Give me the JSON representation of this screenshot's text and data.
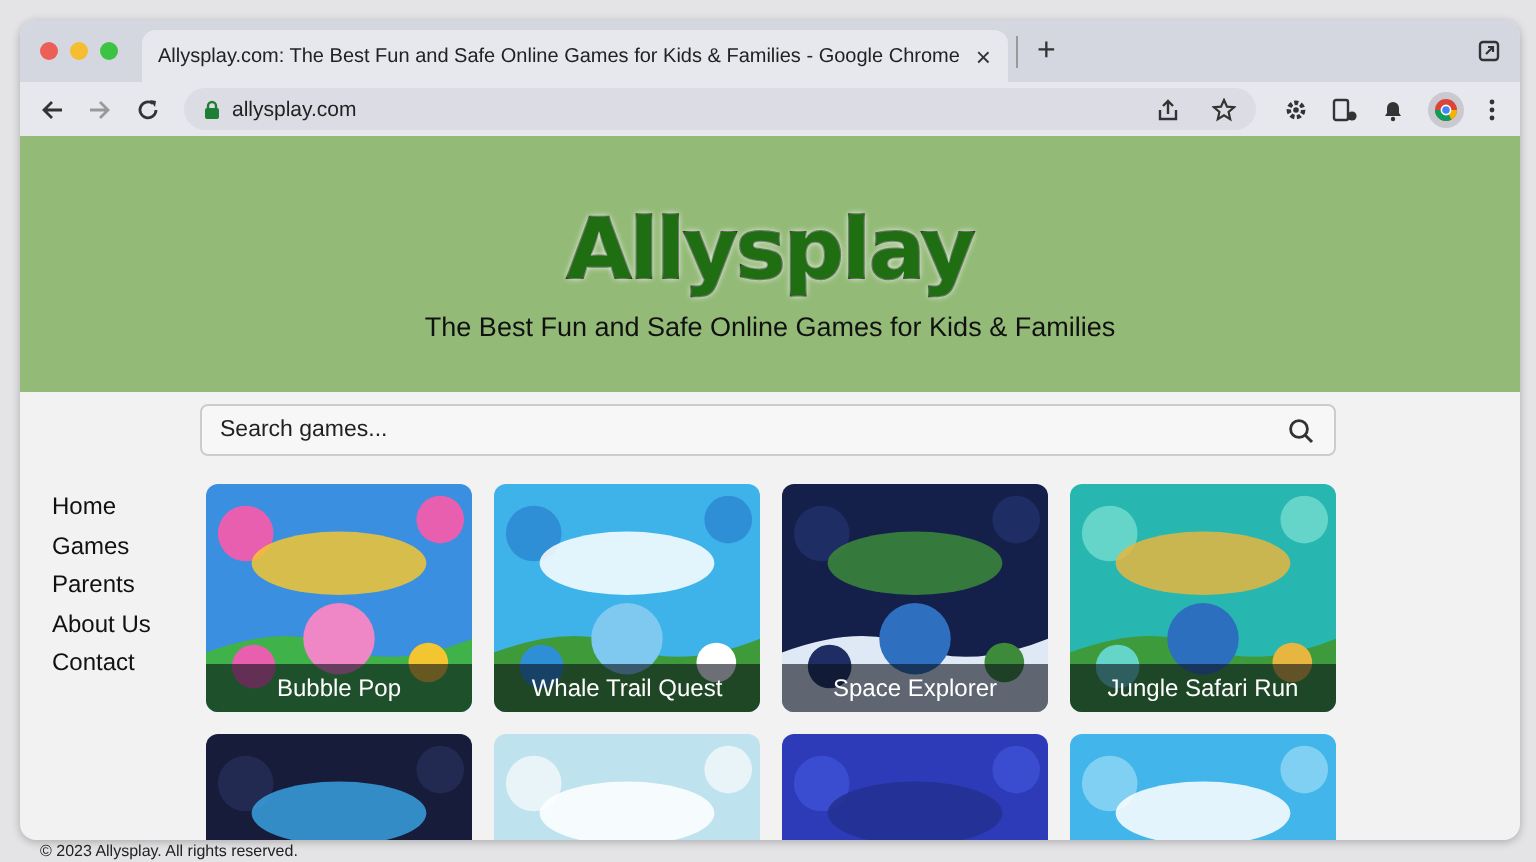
{
  "browser": {
    "tab": {
      "title": "Allysplay.com: The Best Fun and Safe Online Games for Kids & Families - Google Chrome",
      "close": "×"
    },
    "new_tab": "+",
    "url": "allysplay.com"
  },
  "site": {
    "logo": "Allysplay",
    "tagline": "The Best Fun and Safe Online Games for Kids & Families",
    "search": {
      "placeholder": "Search games..."
    },
    "nav": [
      {
        "label": "Home"
      },
      {
        "label": "Games"
      },
      {
        "label": "Parents"
      },
      {
        "label": "About Us"
      },
      {
        "label": "Contact"
      }
    ],
    "games": [
      {
        "kind": "game",
        "title": "Bubble Pop"
      },
      {
        "kind": "game",
        "title": "Whale Trail Quest"
      },
      {
        "kind": "game",
        "title": "Space Explorer"
      },
      {
        "kind": "game",
        "title": "Jungle Safari Run"
      },
      {
        "kind": "picture"
      },
      {
        "kind": "picture"
      },
      {
        "kind": "picture"
      },
      {
        "kind": "picture"
      }
    ]
  },
  "footer": "© 2023 Allysplay. All rights reserved."
}
